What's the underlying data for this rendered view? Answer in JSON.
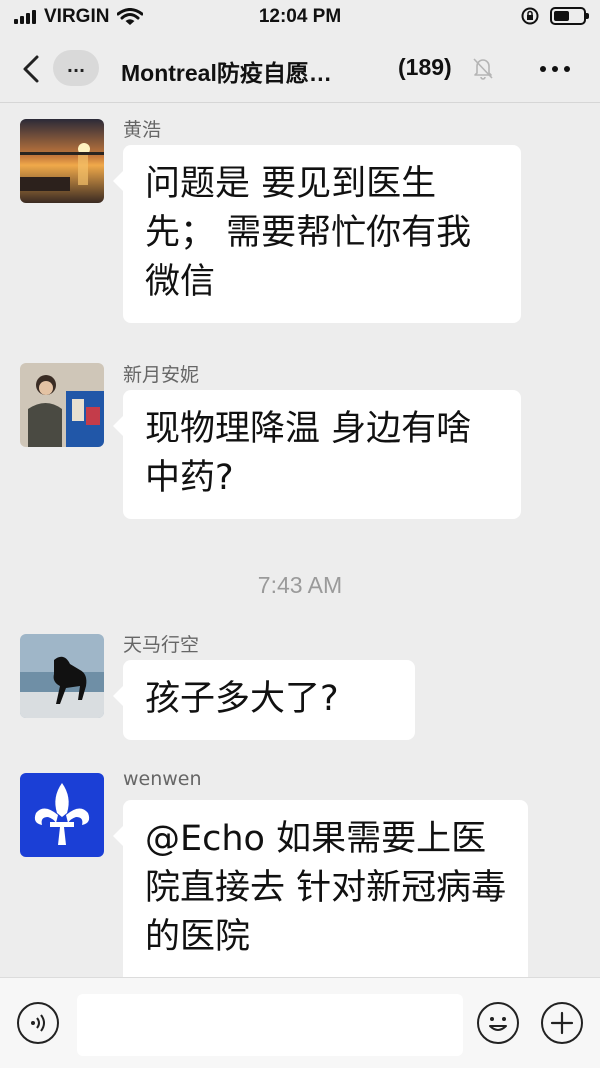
{
  "status_bar": {
    "carrier": "VIRGIN",
    "time": "12:04 PM",
    "battery_level": 0.55
  },
  "header": {
    "more_label": "...",
    "title": "Montreal防疫自愿…",
    "member_count": "(189)"
  },
  "messages": [
    {
      "sender": "黄浩",
      "text": "问题是 要见到医生先； 需要帮忙你有我微信",
      "avatar_icon": "sunset-lake-avatar"
    },
    {
      "sender": "新月安妮",
      "text": "现物理降温 身边有啥中药?",
      "avatar_icon": "person-painting-avatar"
    },
    {
      "sender": "天马行空",
      "text": "孩子多大了?",
      "avatar_icon": "horse-beach-avatar"
    },
    {
      "sender": "wenwen",
      "text": "@Echo 如果需要上医院直接去 针对新冠病毒的医院",
      "avatar_icon": "fleur-de-lis-avatar"
    }
  ],
  "timestamp": "7:43 AM",
  "input": {
    "value": "",
    "placeholder": ""
  },
  "colors": {
    "background": "#ededed",
    "bubble": "#ffffff",
    "quebec_blue": "#1b3fd6"
  }
}
